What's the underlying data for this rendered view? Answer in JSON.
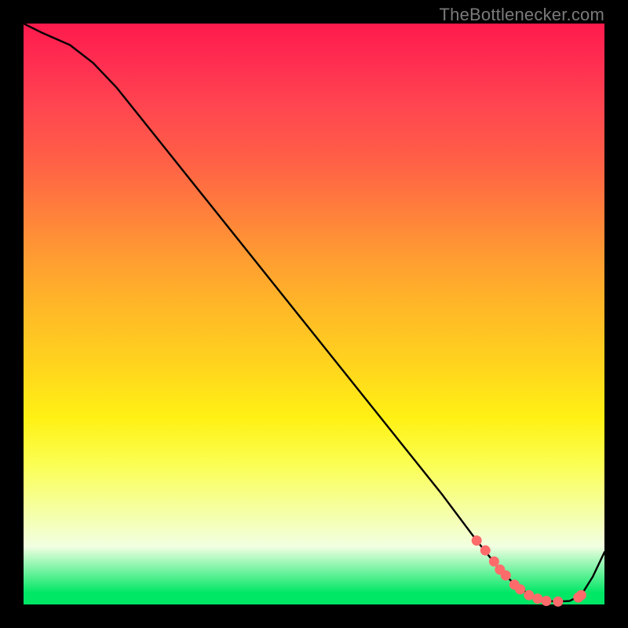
{
  "watermark": "TheBottlenecker.com",
  "colors": {
    "black": "#000000",
    "line": "#000000",
    "dot_fill": "#ff6b6b",
    "dot_stroke": "#ff6b6b",
    "gradient_top": "#ff1a4d",
    "gradient_bottom": "#00e765"
  },
  "chart_data": {
    "type": "line",
    "title": "",
    "xlabel": "",
    "ylabel": "",
    "ylim": [
      0,
      100
    ],
    "xlim": [
      0,
      100
    ],
    "series": [
      {
        "name": "curve",
        "x": [
          0,
          3,
          8,
          12,
          16,
          24,
          32,
          40,
          48,
          56,
          64,
          72,
          78,
          82,
          85,
          88,
          90,
          92,
          94,
          96,
          98,
          100
        ],
        "y": [
          100,
          98.5,
          96.3,
          93.2,
          89.0,
          79.0,
          69.0,
          59.0,
          49.0,
          39.0,
          29.0,
          19.0,
          11.0,
          6.0,
          3.0,
          1.2,
          0.6,
          0.5,
          0.6,
          1.6,
          4.8,
          9.0
        ]
      }
    ],
    "dot_points": [
      {
        "x": 78,
        "y": 11.0
      },
      {
        "x": 79.5,
        "y": 9.3
      },
      {
        "x": 81,
        "y": 7.4
      },
      {
        "x": 82,
        "y": 6.0
      },
      {
        "x": 83,
        "y": 5.0
      },
      {
        "x": 84.5,
        "y": 3.4
      },
      {
        "x": 85.5,
        "y": 2.6
      },
      {
        "x": 87,
        "y": 1.6
      },
      {
        "x": 88.5,
        "y": 1.0
      },
      {
        "x": 90,
        "y": 0.6
      },
      {
        "x": 92,
        "y": 0.5
      },
      {
        "x": 95.5,
        "y": 1.2
      },
      {
        "x": 96,
        "y": 1.6
      }
    ]
  }
}
